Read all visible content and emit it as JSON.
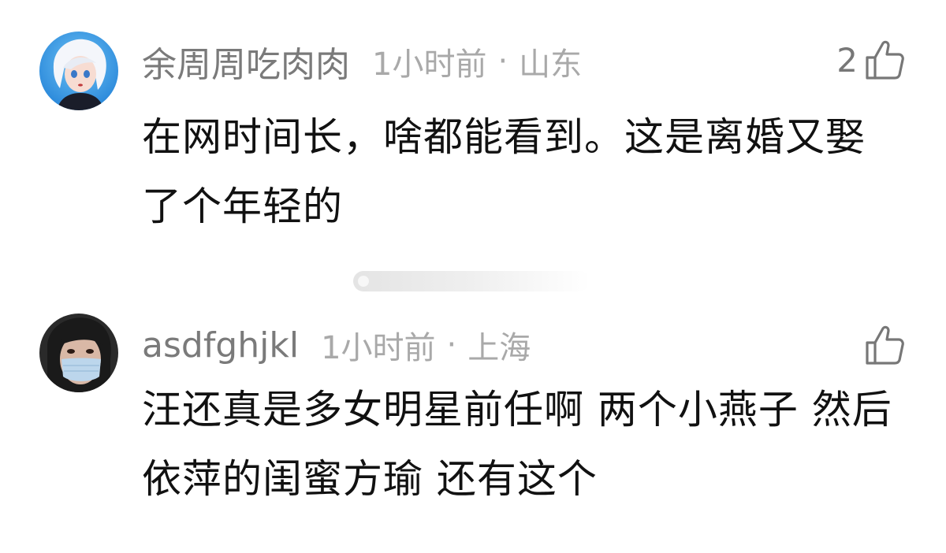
{
  "comments": [
    {
      "username": "余周周吃肉肉",
      "time": "1小时前",
      "separator": "·",
      "location": "山东",
      "likes": "2",
      "text": "在网时间长，啥都能看到。这是离婚又娶了个年轻的",
      "avatar_icon": "anime-girl-avatar"
    },
    {
      "username": "asdfghjkl",
      "time": "1小时前",
      "separator": "·",
      "location": "上海",
      "likes": "",
      "text": "汪还真是多女明星前任啊 两个小燕子 然后依萍的闺蜜方瑜 还有这个",
      "avatar_icon": "masked-person-avatar"
    }
  ],
  "icons": {
    "like": "thumbs-up-icon"
  },
  "colors": {
    "text": "#111111",
    "username": "#7a7a7a",
    "meta": "#a9a9a9",
    "like": "#777777"
  }
}
